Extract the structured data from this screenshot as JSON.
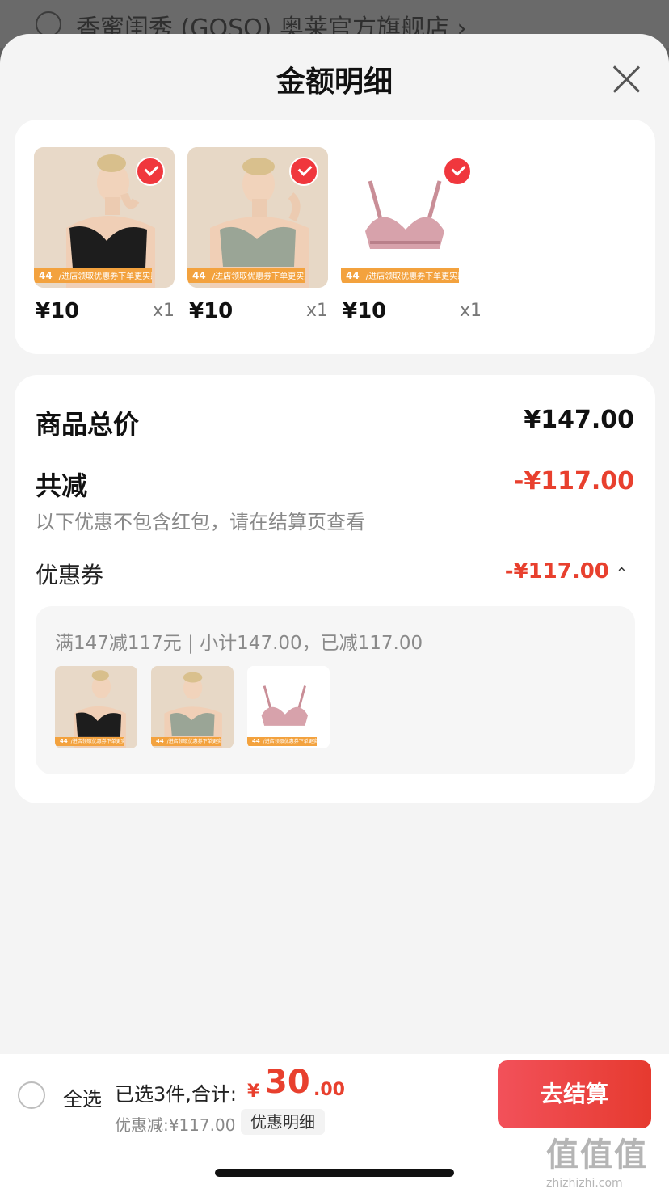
{
  "background_store": {
    "name": "香蜜闺秀 (GOSO) 奥莱官方旗舰店 ›"
  },
  "sheet": {
    "title": "金额明细"
  },
  "products": [
    {
      "price": "¥10",
      "qty": "x1",
      "promo_num": "44",
      "promo_text": "/进店领取优惠券下单更实惠"
    },
    {
      "price": "¥10",
      "qty": "x1",
      "promo_num": "44",
      "promo_text": "/进店领取优惠券下单更实惠"
    },
    {
      "price": "¥10",
      "qty": "x1",
      "promo_num": "44",
      "promo_text": "/进店领取优惠券下单更实惠"
    }
  ],
  "detail": {
    "total_label": "商品总价",
    "total_value": "¥147.00",
    "reduction_label": "共减",
    "reduction_value": "-¥117.00",
    "reduction_note": "以下优惠不包含红包，请在结算页查看",
    "coupon_label": "优惠券",
    "coupon_value": "-¥117.00",
    "coupon_rule": "满147减117元 | 小计147.00，已减117.00"
  },
  "bottom": {
    "select_all": "全选",
    "selected_summary": "已选3件,合计:",
    "total_currency": "¥",
    "total_int": "30",
    "total_dec": ".00",
    "discount": "优惠减:¥117.00",
    "detail_link": "优惠明细",
    "checkout": "去结算"
  },
  "watermark": {
    "glyphs": "值值值",
    "url": "zhizhizhi.com"
  },
  "colors": {
    "accent": "#e8402e",
    "check": "#f0373d",
    "promo": "#f3a23e"
  }
}
